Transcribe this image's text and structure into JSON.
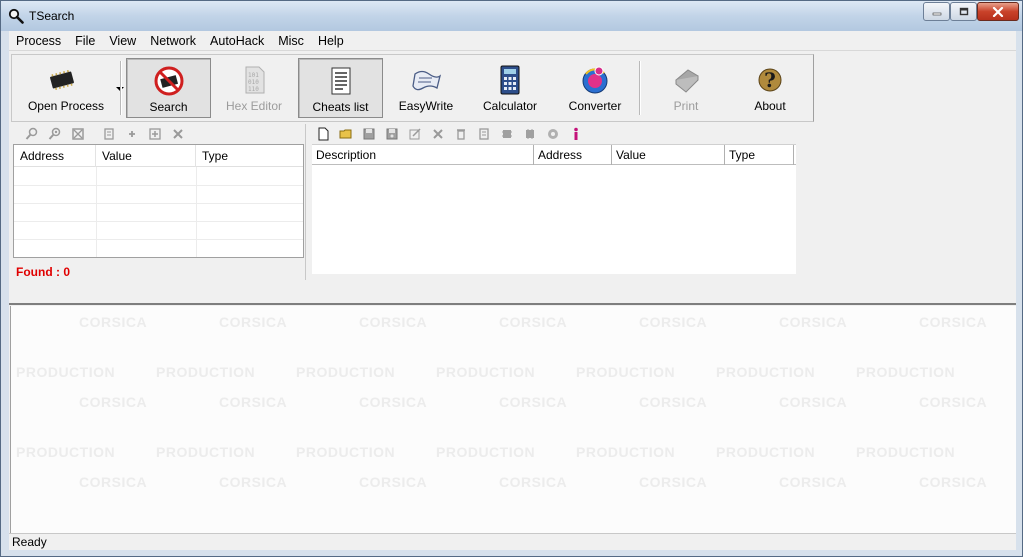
{
  "window": {
    "title": "TSearch"
  },
  "menu": [
    "Process",
    "File",
    "View",
    "Network",
    "AutoHack",
    "Misc",
    "Help"
  ],
  "toolbar": {
    "open_process": "Open Process",
    "search": "Search",
    "hex_editor": "Hex Editor",
    "cheats_list": "Cheats list",
    "easywrite": "EasyWrite",
    "calculator": "Calculator",
    "converter": "Converter",
    "print": "Print",
    "about": "About"
  },
  "search_results": {
    "columns": [
      "Address",
      "Value",
      "Type"
    ],
    "found_label": "Found : 0"
  },
  "cheats": {
    "columns": [
      "Description",
      "Address",
      "Value",
      "Type"
    ]
  },
  "watermark": {
    "line1": "CORSICA",
    "line2": "PRODUCTION"
  },
  "status": "Ready",
  "colors": {
    "found": "#e00000",
    "accent": "#3a6ea5"
  }
}
